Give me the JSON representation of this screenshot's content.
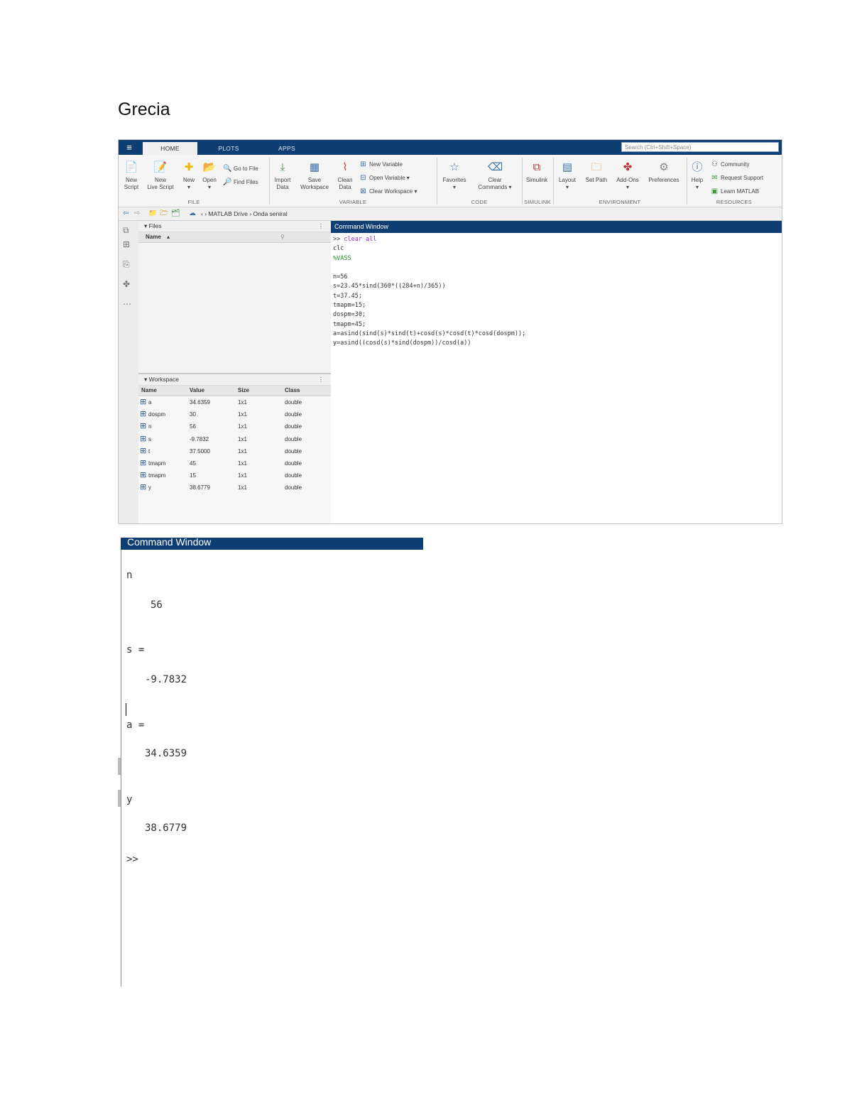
{
  "document": {
    "title": "Grecia"
  },
  "matlab": {
    "tabs": [
      "HOME",
      "PLOTS",
      "APPS"
    ],
    "search_placeholder": "Search (Ctrl+Shift+Space)",
    "ribbon": {
      "file": {
        "section": "FILE",
        "new_script": [
          "New",
          "Script"
        ],
        "new_live_script": [
          "New",
          "Live Script"
        ],
        "new": "New",
        "open": "Open",
        "go_to_file": "Go to File",
        "find_files": "Find Files"
      },
      "variable": {
        "section": "VARIABLE",
        "import_data": [
          "Import",
          "Data"
        ],
        "save_workspace": [
          "Save",
          "Workspace"
        ],
        "clean_data": [
          "Clean",
          "Data"
        ],
        "new_variable": "New Variable",
        "open_variable": "Open Variable",
        "clear_workspace": "Clear Workspace"
      },
      "code": {
        "section": "CODE",
        "favorites": "Favorites",
        "clear_commands": [
          "Clear",
          "Commands"
        ]
      },
      "simulink": {
        "section": "SIMULINK",
        "simulink": "Simulink"
      },
      "environment": {
        "section": "ENVIRONMENT",
        "layout": "Layout",
        "set_path": "Set Path",
        "add_ons": "Add-Ons",
        "preferences": "Preferences"
      },
      "resources": {
        "section": "RESOURCES",
        "help": "Help",
        "community": "Community",
        "request_support": "Request Support",
        "learn_matlab": "Learn MATLAB"
      }
    },
    "address": {
      "path": "MATLAB Drive",
      "folder": "Onda seniral"
    },
    "files_panel": {
      "title": "Files",
      "name_header": "Name"
    },
    "workspace": {
      "title": "Workspace",
      "columns": [
        "Name",
        "Value",
        "Size",
        "Class"
      ],
      "rows": [
        {
          "name": "a",
          "value": "34.6359",
          "size": "1x1",
          "class": "double"
        },
        {
          "name": "dospm",
          "value": "30",
          "size": "1x1",
          "class": "double"
        },
        {
          "name": "n",
          "value": "56",
          "size": "1x1",
          "class": "double"
        },
        {
          "name": "s",
          "value": "-9.7832",
          "size": "1x1",
          "class": "double"
        },
        {
          "name": "t",
          "value": "37.5000",
          "size": "1x1",
          "class": "double"
        },
        {
          "name": "tmapm",
          "value": "45",
          "size": "1x1",
          "class": "double"
        },
        {
          "name": "tmapm",
          "value": "15",
          "size": "1x1",
          "class": "double"
        },
        {
          "name": "y",
          "value": "38.6779",
          "size": "1x1",
          "class": "double"
        }
      ]
    },
    "command_window": {
      "title": "Command Window",
      "lines": [
        {
          "prompt": ">> ",
          "cmd": "clear all"
        },
        {
          "prompt": "",
          "cmd": "clc"
        },
        {
          "prompt": "",
          "cmd": "%VASS",
          "comment": true
        },
        {
          "prompt": "",
          "cmd": ""
        },
        {
          "prompt": "",
          "cmd": "n=56"
        },
        {
          "prompt": "",
          "cmd": "s=23.45*sind(360*((284+n)/365))"
        },
        {
          "prompt": "",
          "cmd": "t=37.45;"
        },
        {
          "prompt": "",
          "cmd": "tmapm=15;"
        },
        {
          "prompt": "",
          "cmd": "dospm=30;"
        },
        {
          "prompt": "",
          "cmd": "tmapm=45;"
        },
        {
          "prompt": "",
          "cmd": "a=asind(sind(s)*sind(t)+cosd(s)*cosd(t)*cosd(dospm));"
        },
        {
          "prompt": "",
          "cmd": "y=asind((cosd(s)*sind(dospm))/cosd(a))"
        }
      ]
    }
  },
  "command_output": {
    "title": "Command Window",
    "n_label": "n",
    "n_value": "56",
    "s_label": "s =",
    "s_value": "-9.7832",
    "a_label": "a =",
    "a_value": "34.6359",
    "y_label": "y",
    "y_value": "38.6779",
    "prompt": ">>"
  }
}
